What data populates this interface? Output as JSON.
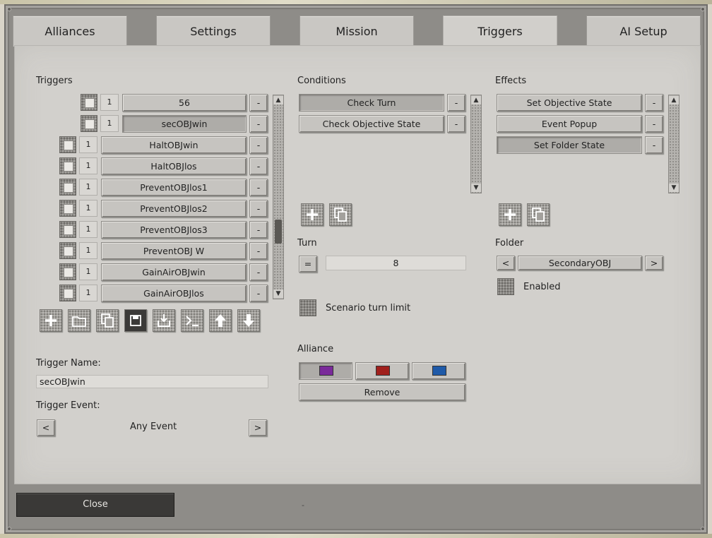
{
  "tabs": [
    {
      "label": "Alliances"
    },
    {
      "label": "Settings"
    },
    {
      "label": "Mission"
    },
    {
      "label": "Triggers"
    },
    {
      "label": "AI Setup"
    }
  ],
  "triggers": {
    "header": "Triggers",
    "items": [
      {
        "count": "1",
        "name": "56"
      },
      {
        "count": "1",
        "name": "secOBJwin"
      },
      {
        "count": "1",
        "name": "HaltOBJwin"
      },
      {
        "count": "1",
        "name": "HaltOBJlos"
      },
      {
        "count": "1",
        "name": "PreventOBJlos1"
      },
      {
        "count": "1",
        "name": "PreventOBJlos2"
      },
      {
        "count": "1",
        "name": "PreventOBJlos3"
      },
      {
        "count": "1",
        "name": "PreventOBJ W"
      },
      {
        "count": "1",
        "name": "GainAirOBJwin"
      },
      {
        "count": "1",
        "name": "GainAirOBJlos"
      }
    ],
    "remove_label": "-",
    "toolbar": [
      "add-icon",
      "folder-icon",
      "copy-icon",
      "save-icon",
      "import-icon",
      "console-icon",
      "arrow-up-icon",
      "arrow-down-icon"
    ]
  },
  "trigger_name": {
    "label": "Trigger Name:",
    "value": "secOBJwin"
  },
  "trigger_event": {
    "label": "Trigger Event:",
    "prev": "<",
    "value": "Any Event",
    "next": ">"
  },
  "conditions": {
    "header": "Conditions",
    "items": [
      {
        "name": "Check Turn"
      },
      {
        "name": "Check Objective State"
      }
    ],
    "remove_label": "-"
  },
  "turn": {
    "label": "Turn",
    "operator": "=",
    "value": "8"
  },
  "scenario_turn_limit": {
    "label": "Scenario turn limit"
  },
  "alliance": {
    "label": "Alliance",
    "colors": [
      "#7a2a9a",
      "#a0201c",
      "#1f5aa8"
    ],
    "remove_label": "Remove"
  },
  "effects": {
    "header": "Effects",
    "items": [
      {
        "name": "Set Objective State"
      },
      {
        "name": "Event Popup"
      },
      {
        "name": "Set Folder State"
      }
    ],
    "remove_label": "-"
  },
  "folder": {
    "label": "Folder",
    "prev": "<",
    "value": "SecondaryOBJ",
    "next": ">"
  },
  "enabled": {
    "label": "Enabled"
  },
  "close_label": "Close",
  "footer_mark": "-"
}
